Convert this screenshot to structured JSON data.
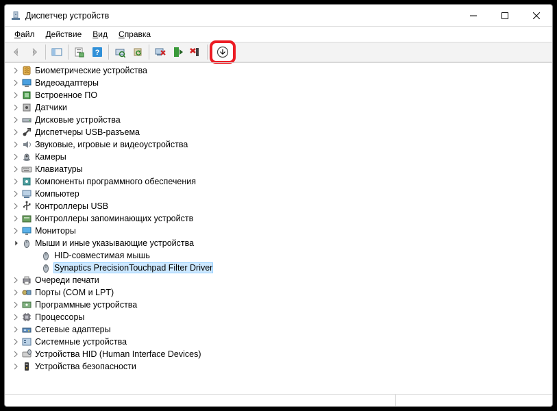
{
  "title": "Диспетчер устройств",
  "menus": {
    "file": "Файл",
    "action": "Действие",
    "view": "Вид",
    "help": "Справка"
  },
  "highlight_color": "#ec1c24",
  "tree": [
    {
      "icon": "biometric",
      "label": "Биометрические устройства",
      "expanded": false
    },
    {
      "icon": "display",
      "label": "Видеоадаптеры",
      "expanded": false
    },
    {
      "icon": "firmware",
      "label": "Встроенное ПО",
      "expanded": false
    },
    {
      "icon": "sensor",
      "label": "Датчики",
      "expanded": false
    },
    {
      "icon": "disk",
      "label": "Дисковые устройства",
      "expanded": false
    },
    {
      "icon": "usb",
      "label": "Диспетчеры USB-разъема",
      "expanded": false
    },
    {
      "icon": "audio",
      "label": "Звуковые, игровые и видеоустройства",
      "expanded": false
    },
    {
      "icon": "camera",
      "label": "Камеры",
      "expanded": false
    },
    {
      "icon": "keyboard",
      "label": "Клавиатуры",
      "expanded": false
    },
    {
      "icon": "sw",
      "label": "Компоненты программного обеспечения",
      "expanded": false
    },
    {
      "icon": "computer",
      "label": "Компьютер",
      "expanded": false
    },
    {
      "icon": "usbctrl",
      "label": "Контроллеры USB",
      "expanded": false
    },
    {
      "icon": "storage",
      "label": "Контроллеры запоминающих устройств",
      "expanded": false
    },
    {
      "icon": "monitor",
      "label": "Мониторы",
      "expanded": false
    },
    {
      "icon": "mouse",
      "label": "Мыши и иные указывающие устройства",
      "expanded": true,
      "children": [
        {
          "icon": "mouse",
          "label": "HID-совместимая мышь",
          "selected": false
        },
        {
          "icon": "mouse",
          "label": "Synaptics PrecisionTouchpad Filter Driver",
          "selected": true
        }
      ]
    },
    {
      "icon": "printer",
      "label": "Очереди печати",
      "expanded": false
    },
    {
      "icon": "port",
      "label": "Порты (COM и LPT)",
      "expanded": false
    },
    {
      "icon": "swdev",
      "label": "Программные устройства",
      "expanded": false
    },
    {
      "icon": "cpu",
      "label": "Процессоры",
      "expanded": false
    },
    {
      "icon": "network",
      "label": "Сетевые адаптеры",
      "expanded": false
    },
    {
      "icon": "system",
      "label": "Системные устройства",
      "expanded": false
    },
    {
      "icon": "hid",
      "label": "Устройства HID (Human Interface Devices)",
      "expanded": false
    },
    {
      "icon": "security",
      "label": "Устройства безопасности",
      "expanded": false
    }
  ]
}
